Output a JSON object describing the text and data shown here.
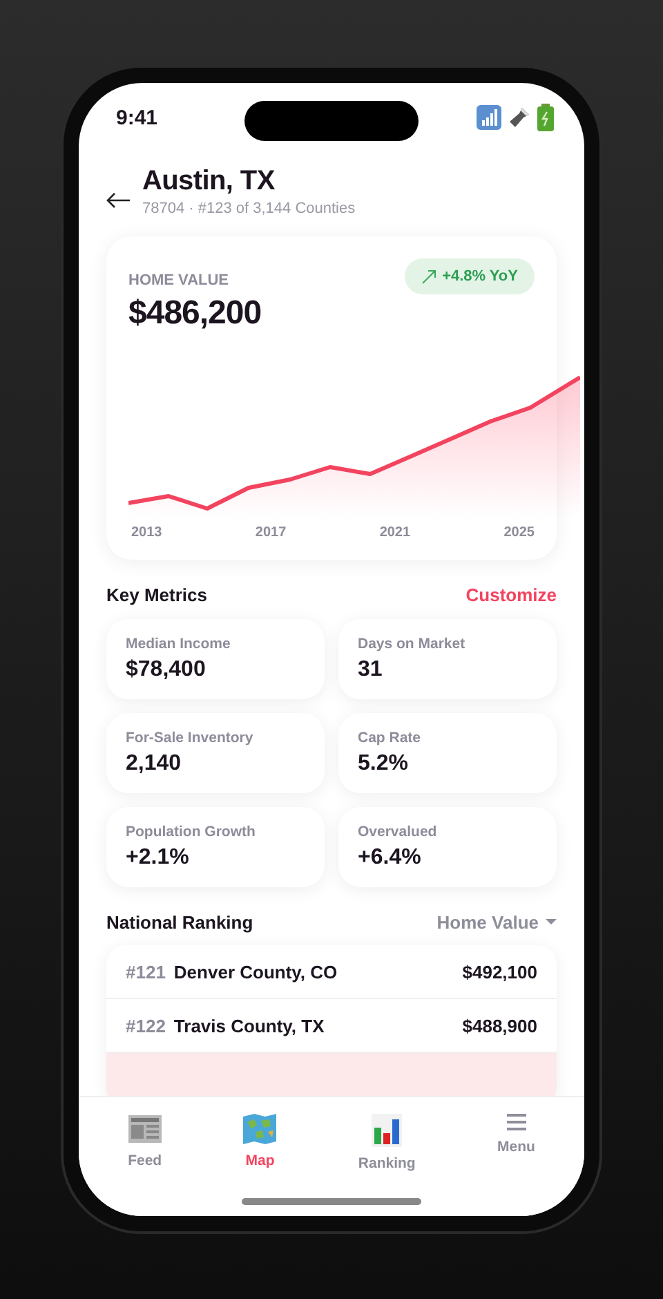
{
  "status_bar": {
    "time": "9:41"
  },
  "header": {
    "title": "Austin, TX",
    "subtitle": "78704 · #123 of 3,144 Counties"
  },
  "home_value": {
    "label": "HOME VALUE",
    "value": "$486,200",
    "change": "+4.8% YoY",
    "x_labels": [
      "2013",
      "2017",
      "2021",
      "2025"
    ]
  },
  "key_metrics": {
    "title": "Key Metrics",
    "action": "Customize",
    "items": [
      {
        "label": "Median Income",
        "value": "$78,400"
      },
      {
        "label": "Days on Market",
        "value": "31"
      },
      {
        "label": "For-Sale Inventory",
        "value": "2,140"
      },
      {
        "label": "Cap Rate",
        "value": "5.2%"
      },
      {
        "label": "Population Growth",
        "value": "+2.1%"
      },
      {
        "label": "Overvalued",
        "value": "+6.4%"
      }
    ]
  },
  "ranking": {
    "title": "National Ranking",
    "sort": "Home Value",
    "rows": [
      {
        "rank": "#121",
        "name": "Denver County, CO",
        "value": "$492,100",
        "selected": false
      },
      {
        "rank": "#122",
        "name": "Travis County, TX",
        "value": "$488,900",
        "selected": false
      },
      {
        "selected": true
      }
    ]
  },
  "tab_bar": [
    {
      "kind": "feed",
      "label": "Feed",
      "selected": false
    },
    {
      "kind": "map",
      "label": "Map",
      "selected": true
    },
    {
      "kind": "ranking",
      "label": "Ranking",
      "selected": false
    },
    {
      "kind": "menu",
      "label": "Menu",
      "selected": false
    }
  ]
}
